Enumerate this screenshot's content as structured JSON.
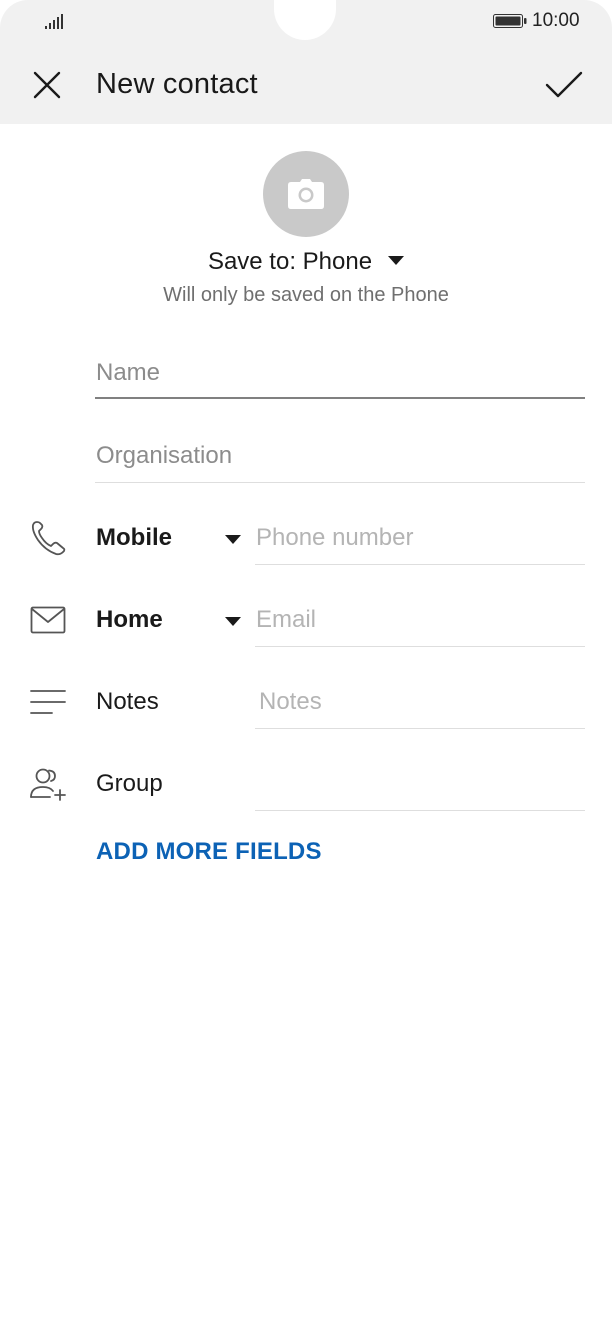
{
  "status": {
    "time": "10:00"
  },
  "app_bar": {
    "title": "New contact",
    "close_icon": "close-icon",
    "confirm_icon": "check-icon"
  },
  "avatar": {
    "icon": "camera-icon"
  },
  "save_to": {
    "label": "Save to: Phone",
    "note": "Will only be saved on the Phone"
  },
  "fields": {
    "name": {
      "placeholder": "Name"
    },
    "organisation": {
      "placeholder": "Organisation"
    },
    "phone": {
      "type": "Mobile",
      "placeholder": "Phone number"
    },
    "email": {
      "type": "Home",
      "placeholder": "Email"
    },
    "notes": {
      "label": "Notes",
      "placeholder": "Notes"
    },
    "group": {
      "label": "Group"
    }
  },
  "add_more": {
    "label": "ADD MORE FIELDS"
  },
  "colors": {
    "accent": "#0c62b5",
    "bar_bg": "#f1f1f1",
    "avatar_bg": "#c9c9c9"
  }
}
